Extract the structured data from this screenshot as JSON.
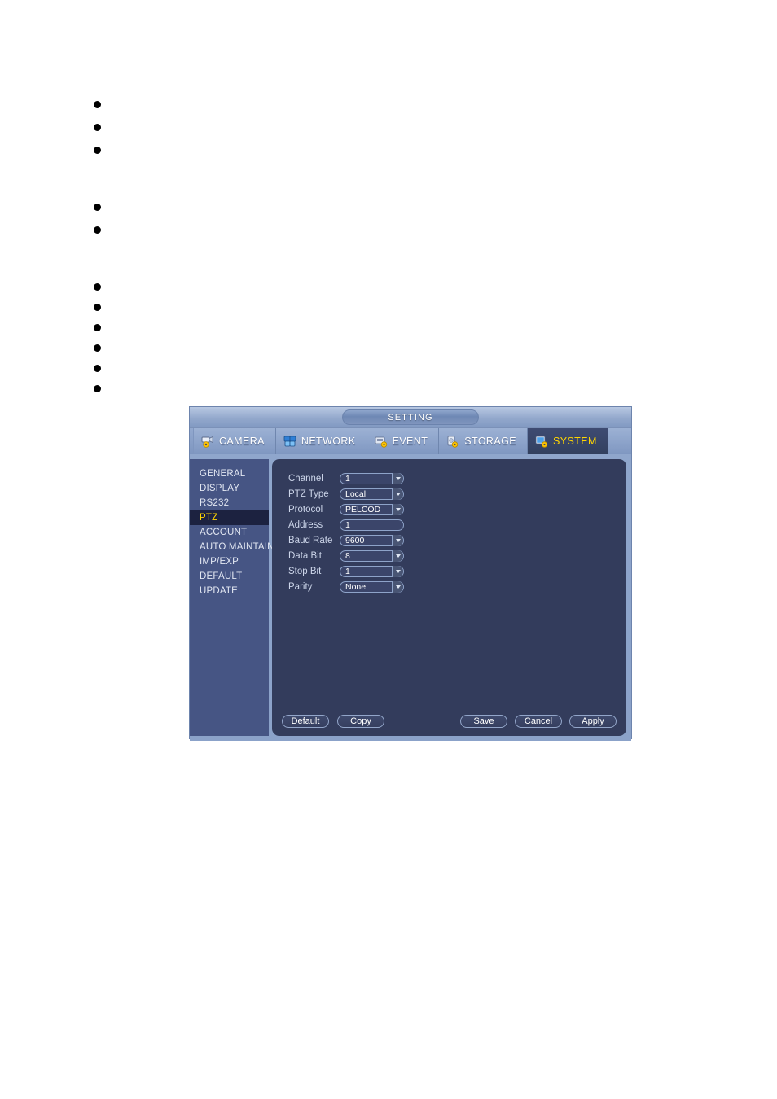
{
  "document": {
    "bullet_groups": [
      {
        "items": [
          {
            "text": ""
          },
          {
            "text": ""
          },
          {
            "text": ""
          }
        ]
      },
      {
        "items": [
          {
            "text": ""
          },
          {
            "text": ""
          }
        ]
      },
      {
        "items": [
          {
            "text": ""
          },
          {
            "text": ""
          },
          {
            "text": ""
          },
          {
            "text": ""
          },
          {
            "text": ""
          },
          {
            "text": ""
          }
        ]
      }
    ]
  },
  "dvr": {
    "title": "SETTING",
    "tabs": [
      {
        "label": "CAMERA",
        "icon": "camera-icon",
        "active": false
      },
      {
        "label": "NETWORK",
        "icon": "network-icon",
        "active": false
      },
      {
        "label": "EVENT",
        "icon": "event-icon",
        "active": false
      },
      {
        "label": "STORAGE",
        "icon": "storage-icon",
        "active": false
      },
      {
        "label": "SYSTEM",
        "icon": "system-icon",
        "active": true
      }
    ],
    "sidebar": {
      "items": [
        {
          "label": "GENERAL",
          "active": false
        },
        {
          "label": "DISPLAY",
          "active": false
        },
        {
          "label": "RS232",
          "active": false
        },
        {
          "label": "PTZ",
          "active": true
        },
        {
          "label": "ACCOUNT",
          "active": false
        },
        {
          "label": "AUTO MAINTAIN",
          "active": false
        },
        {
          "label": "IMP/EXP",
          "active": false
        },
        {
          "label": "DEFAULT",
          "active": false
        },
        {
          "label": "UPDATE",
          "active": false
        }
      ]
    },
    "form": {
      "fields": [
        {
          "label": "Channel",
          "value": "1",
          "type": "select"
        },
        {
          "label": "PTZ Type",
          "value": "Local",
          "type": "select"
        },
        {
          "label": "Protocol",
          "value": "PELCOD",
          "type": "select"
        },
        {
          "label": "Address",
          "value": "1",
          "type": "text"
        },
        {
          "label": "Baud Rate",
          "value": "9600",
          "type": "select"
        },
        {
          "label": "Data Bit",
          "value": "8",
          "type": "select"
        },
        {
          "label": "Stop Bit",
          "value": "1",
          "type": "select"
        },
        {
          "label": "Parity",
          "value": "None",
          "type": "select"
        }
      ]
    },
    "buttons": {
      "left": [
        {
          "label": "Default"
        },
        {
          "label": "Copy"
        }
      ],
      "right": [
        {
          "label": "Save"
        },
        {
          "label": "Cancel"
        },
        {
          "label": "Apply"
        }
      ]
    },
    "colors": {
      "accent_yellow": "#ffd500",
      "panel_bg": "#333c5c",
      "sidebar_bg": "#465584",
      "active_item_bg": "#1c2240",
      "window_chrome": "#8fa6cc"
    }
  }
}
